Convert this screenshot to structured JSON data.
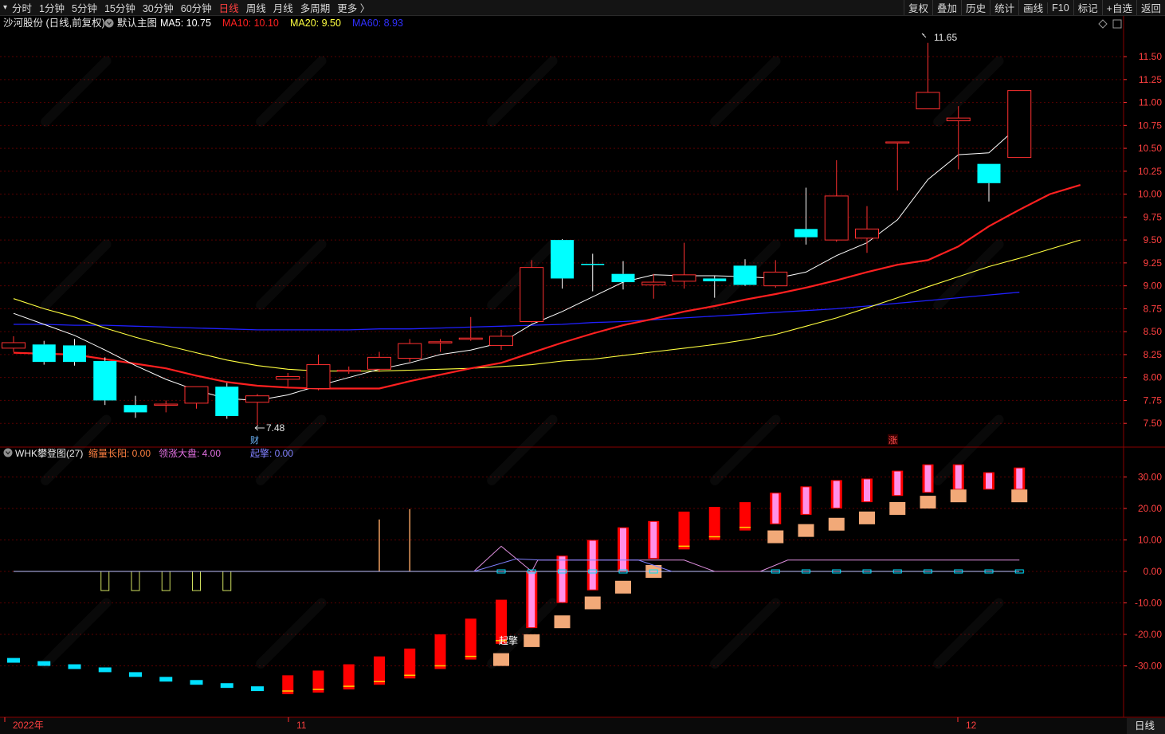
{
  "top_nav": {
    "periods": [
      "分时",
      "1分钟",
      "5分钟",
      "15分钟",
      "30分钟",
      "60分钟",
      "日线",
      "周线",
      "月线",
      "多周期",
      "更多 〉"
    ],
    "active_period": "日线",
    "tools": [
      "复权",
      "叠加",
      "历史",
      "统计",
      "画线",
      "F10",
      "标记",
      "+自选",
      "返回"
    ]
  },
  "main_panel": {
    "stock_title": "沙河股份 (日线,前复权)",
    "indicator_name": "默认主图",
    "ma": [
      {
        "label": "MA5: 10.75",
        "color": "#ffffff"
      },
      {
        "label": "MA10: 10.10",
        "color": "#ff2020"
      },
      {
        "label": "MA20: 9.50",
        "color": "#ffff40"
      },
      {
        "label": "MA60: 8.93",
        "color": "#3030ff"
      }
    ],
    "high_label": "11.65",
    "low_label": "7.48",
    "marker_cai": "财",
    "marker_zhang": "涨",
    "price_ticks": [
      "11.50",
      "11.25",
      "11.00",
      "10.75",
      "10.50",
      "10.25",
      "10.00",
      "9.75",
      "9.50",
      "9.25",
      "9.00",
      "8.75",
      "8.50",
      "8.25",
      "8.00",
      "7.75",
      "7.50"
    ]
  },
  "sub_panel": {
    "indicator_title": "WHK攀登图(27)",
    "legend": [
      {
        "label": "缩量长阳: 0.00",
        "color": "#ff8040"
      },
      {
        "label": "领涨大盘: 4.00",
        "color": "#e070e0"
      },
      {
        "label": "起擎: 0.00",
        "color": "#8080ff"
      }
    ],
    "start_label": "起擎",
    "value_ticks": [
      "30.00",
      "20.00",
      "10.00",
      "0.00",
      "-10.00",
      "-20.00",
      "-30.00"
    ]
  },
  "time_axis": {
    "labels": [
      "2022年",
      "11",
      "12"
    ],
    "period_label": "日线"
  },
  "colors": {
    "up": "#ff3030",
    "down": "#00ffff",
    "ma5": "#ffffff",
    "ma10": "#ff2020",
    "ma20": "#ffff40",
    "ma60": "#2020ff"
  },
  "chart_data": [
    {
      "type": "candlestick",
      "title": "沙河股份 (日线,前复权)",
      "y_range": [
        7.38,
        11.77
      ],
      "candles": [
        {
          "o": 8.32,
          "h": 8.45,
          "l": 8.28,
          "c": 8.38
        },
        {
          "o": 8.36,
          "h": 8.4,
          "l": 8.14,
          "c": 8.17
        },
        {
          "o": 8.35,
          "h": 8.42,
          "l": 8.13,
          "c": 8.17
        },
        {
          "o": 8.18,
          "h": 8.22,
          "l": 7.7,
          "c": 7.75
        },
        {
          "o": 7.7,
          "h": 7.8,
          "l": 7.56,
          "c": 7.62
        },
        {
          "o": 7.7,
          "h": 7.75,
          "l": 7.62,
          "c": 7.71
        },
        {
          "o": 7.72,
          "h": 7.9,
          "l": 7.66,
          "c": 7.9
        },
        {
          "o": 7.9,
          "h": 7.94,
          "l": 7.55,
          "c": 7.58
        },
        {
          "o": 7.73,
          "h": 7.82,
          "l": 7.48,
          "c": 7.8
        },
        {
          "o": 7.98,
          "h": 8.05,
          "l": 7.9,
          "c": 8.01
        },
        {
          "o": 7.88,
          "h": 8.25,
          "l": 7.86,
          "c": 8.14
        },
        {
          "o": 8.07,
          "h": 8.12,
          "l": 8.04,
          "c": 8.08
        },
        {
          "o": 8.09,
          "h": 8.28,
          "l": 8.06,
          "c": 8.22
        },
        {
          "o": 8.21,
          "h": 8.42,
          "l": 8.17,
          "c": 8.37
        },
        {
          "o": 8.38,
          "h": 8.42,
          "l": 8.28,
          "c": 8.39
        },
        {
          "o": 8.42,
          "h": 8.66,
          "l": 8.4,
          "c": 8.43
        },
        {
          "o": 8.35,
          "h": 8.52,
          "l": 8.3,
          "c": 8.45
        },
        {
          "o": 8.61,
          "h": 9.28,
          "l": 8.6,
          "c": 9.2
        },
        {
          "o": 9.5,
          "h": 9.51,
          "l": 8.97,
          "c": 9.08
        },
        {
          "o": 9.24,
          "h": 9.35,
          "l": 8.94,
          "c": 9.23
        },
        {
          "o": 9.13,
          "h": 9.27,
          "l": 8.96,
          "c": 9.04
        },
        {
          "o": 9.01,
          "h": 9.13,
          "l": 8.86,
          "c": 9.04
        },
        {
          "o": 9.05,
          "h": 9.47,
          "l": 8.97,
          "c": 9.12
        },
        {
          "o": 9.08,
          "h": 9.11,
          "l": 8.87,
          "c": 9.05
        },
        {
          "o": 9.22,
          "h": 9.29,
          "l": 9.0,
          "c": 9.01
        },
        {
          "o": 9.0,
          "h": 9.28,
          "l": 8.98,
          "c": 9.15
        },
        {
          "o": 9.62,
          "h": 10.07,
          "l": 9.45,
          "c": 9.53
        },
        {
          "o": 9.5,
          "h": 10.37,
          "l": 9.48,
          "c": 9.98
        },
        {
          "o": 9.52,
          "h": 9.87,
          "l": 9.36,
          "c": 9.62
        },
        {
          "o": 10.57,
          "h": 10.57,
          "l": 10.04,
          "c": 10.57
        },
        {
          "o": 10.93,
          "h": 11.65,
          "l": 10.93,
          "c": 11.11
        },
        {
          "o": 10.8,
          "h": 10.96,
          "l": 10.27,
          "c": 10.83
        },
        {
          "o": 10.33,
          "h": 10.33,
          "l": 9.92,
          "c": 10.12
        },
        {
          "o": 10.4,
          "h": 11.13,
          "l": 10.4,
          "c": 11.13
        }
      ],
      "ma5": [
        8.7,
        8.58,
        8.46,
        8.3,
        8.13,
        7.98,
        7.86,
        7.77,
        7.75,
        7.81,
        7.91,
        8.0,
        8.09,
        8.16,
        8.25,
        8.3,
        8.38,
        8.58,
        8.72,
        8.88,
        9.04,
        9.12,
        9.11,
        9.11,
        9.1,
        9.08,
        9.15,
        9.33,
        9.47,
        9.72,
        10.16,
        10.43,
        10.45,
        10.75
      ],
      "ma10": [
        8.27,
        8.26,
        8.25,
        8.2,
        8.15,
        8.1,
        8.02,
        7.95,
        7.91,
        7.89,
        7.88,
        7.88,
        7.88,
        7.96,
        8.03,
        8.1,
        8.16,
        8.27,
        8.38,
        8.48,
        8.57,
        8.64,
        8.72,
        8.78,
        8.85,
        8.91,
        8.98,
        9.06,
        9.15,
        9.23,
        9.28,
        9.43,
        9.65,
        9.83,
        10.0,
        10.1
      ],
      "ma20": [
        8.86,
        8.75,
        8.66,
        8.54,
        8.44,
        8.35,
        8.27,
        8.19,
        8.13,
        8.09,
        8.07,
        8.07,
        8.07,
        8.08,
        8.09,
        8.1,
        8.12,
        8.14,
        8.18,
        8.2,
        8.24,
        8.28,
        8.32,
        8.36,
        8.41,
        8.47,
        8.56,
        8.65,
        8.76,
        8.87,
        8.99,
        9.1,
        9.21,
        9.3,
        9.4,
        9.5
      ],
      "ma60": [
        8.58,
        8.58,
        8.57,
        8.57,
        8.56,
        8.55,
        8.54,
        8.53,
        8.52,
        8.52,
        8.52,
        8.52,
        8.53,
        8.53,
        8.54,
        8.55,
        8.56,
        8.57,
        8.58,
        8.6,
        8.61,
        8.63,
        8.65,
        8.67,
        8.69,
        8.71,
        8.73,
        8.75,
        8.78,
        8.81,
        8.84,
        8.87,
        8.9,
        8.93
      ]
    },
    {
      "type": "bar",
      "title": "WHK攀登图(27)",
      "y_range": [
        -38,
        40
      ],
      "staircase": [
        {
          "lo": -29,
          "hi": -27.5,
          "kind": "cyan"
        },
        {
          "lo": -30,
          "hi": -28.5,
          "kind": "cyan"
        },
        {
          "lo": -31,
          "hi": -29.5,
          "kind": "cyan"
        },
        {
          "lo": -32,
          "hi": -30.5,
          "kind": "cyan"
        },
        {
          "lo": -33.5,
          "hi": -32,
          "kind": "cyan"
        },
        {
          "lo": -35,
          "hi": -33.5,
          "kind": "cyan"
        },
        {
          "lo": -36,
          "hi": -34.5,
          "kind": "cyan"
        },
        {
          "lo": -37,
          "hi": -35.5,
          "kind": "cyan"
        },
        {
          "lo": -38,
          "hi": -36.5,
          "kind": "cyan"
        },
        {
          "lo": -39,
          "hi": -33,
          "kind": "red"
        },
        {
          "lo": -38.5,
          "hi": -31.5,
          "kind": "red"
        },
        {
          "lo": -37.5,
          "hi": -29.5,
          "kind": "red"
        },
        {
          "lo": -36,
          "hi": -27,
          "kind": "red"
        },
        {
          "lo": -34,
          "hi": -24.5,
          "kind": "red"
        },
        {
          "lo": -31,
          "hi": -20,
          "kind": "red"
        },
        {
          "lo": -28,
          "hi": -15,
          "kind": "red"
        },
        {
          "lo": -23,
          "hi": -9,
          "kind": "red"
        },
        {
          "lo": -18,
          "hi": 0,
          "kind": "pink"
        },
        {
          "lo": -10,
          "hi": 5,
          "kind": "pink"
        },
        {
          "lo": -6,
          "hi": 10,
          "kind": "pink"
        },
        {
          "lo": 0,
          "hi": 14,
          "kind": "pink"
        },
        {
          "lo": 4,
          "hi": 16,
          "kind": "pink"
        },
        {
          "lo": 7,
          "hi": 19,
          "kind": "red"
        },
        {
          "lo": 10,
          "hi": 20.5,
          "kind": "red"
        },
        {
          "lo": 13,
          "hi": 22,
          "kind": "red"
        },
        {
          "lo": 15,
          "hi": 25,
          "kind": "pink"
        },
        {
          "lo": 18,
          "hi": 27,
          "kind": "pink"
        },
        {
          "lo": 20,
          "hi": 29,
          "kind": "pink"
        },
        {
          "lo": 22,
          "hi": 29.5,
          "kind": "pink"
        },
        {
          "lo": 24,
          "hi": 32,
          "kind": "pink"
        },
        {
          "lo": 25,
          "hi": 34,
          "kind": "pink"
        },
        {
          "lo": 26,
          "hi": 34,
          "kind": "pink"
        },
        {
          "lo": 26,
          "hi": 31.5,
          "kind": "pink"
        },
        {
          "lo": 26,
          "hi": 33,
          "kind": "pink"
        }
      ],
      "tan_blocks": [
        {
          "i": 16,
          "v": -28
        },
        {
          "i": 17,
          "v": -22
        },
        {
          "i": 18,
          "v": -16
        },
        {
          "i": 19,
          "v": -10
        },
        {
          "i": 20,
          "v": -5
        },
        {
          "i": 21,
          "v": 0
        },
        {
          "i": 25,
          "v": 11
        },
        {
          "i": 26,
          "v": 13
        },
        {
          "i": 27,
          "v": 15
        },
        {
          "i": 28,
          "v": 17
        },
        {
          "i": 29,
          "v": 20
        },
        {
          "i": 30,
          "v": 22
        },
        {
          "i": 31,
          "v": 24
        },
        {
          "i": 33,
          "v": 24
        }
      ],
      "yellow_outline": [
        3,
        4,
        5,
        6,
        7
      ],
      "orange_spikes": [
        {
          "i": 12,
          "v": 16.5
        },
        {
          "i": 13,
          "v": 19.8
        }
      ],
      "lingzhang_line": [
        [
          15.1,
          0
        ],
        [
          16.0,
          8
        ],
        [
          17.0,
          0
        ],
        [
          17.2,
          3.6
        ],
        [
          22.0,
          3.6
        ],
        [
          23.0,
          0
        ],
        [
          24.5,
          0
        ],
        [
          25.4,
          3.6
        ],
        [
          33.0,
          3.6
        ]
      ],
      "qiqing_line": [
        [
          15.1,
          0
        ],
        [
          16.5,
          4
        ],
        [
          17.3,
          3.6
        ],
        [
          20.5,
          3.6
        ],
        [
          21.6,
          0
        ]
      ],
      "cyan_dots_from": 16
    }
  ]
}
